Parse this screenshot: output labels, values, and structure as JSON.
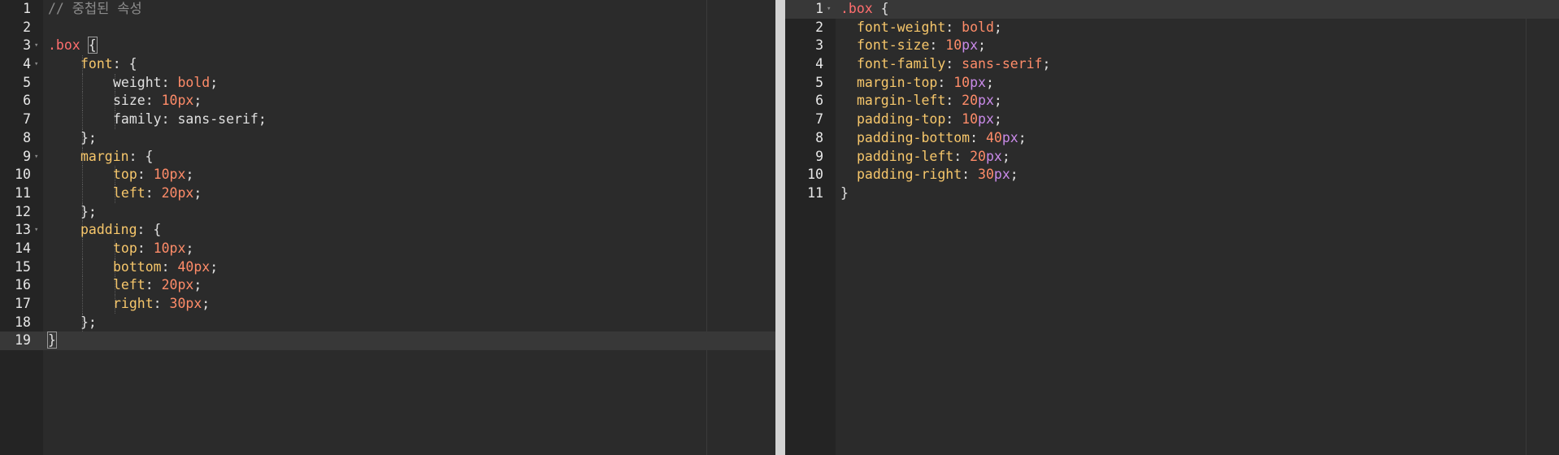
{
  "left_editor": {
    "lines": [
      {
        "n": "1",
        "fold": false,
        "indent": 0,
        "tokens": [
          {
            "t": "// 중첩된 속성",
            "c": "comment"
          }
        ]
      },
      {
        "n": "2",
        "fold": false,
        "indent": 0,
        "tokens": []
      },
      {
        "n": "3",
        "fold": true,
        "indent": 0,
        "tokens": [
          {
            "t": ".box",
            "c": "selector"
          },
          {
            "t": " ",
            "c": "plain"
          },
          {
            "t": "{",
            "c": "punct",
            "box": true
          }
        ]
      },
      {
        "n": "4",
        "fold": true,
        "indent": 1,
        "tokens": [
          {
            "t": "font",
            "c": "prop"
          },
          {
            "t": ": {",
            "c": "punct"
          }
        ]
      },
      {
        "n": "5",
        "fold": false,
        "indent": 2,
        "tokens": [
          {
            "t": "weight",
            "c": "plain"
          },
          {
            "t": ": ",
            "c": "punct"
          },
          {
            "t": "bold",
            "c": "value"
          },
          {
            "t": ";",
            "c": "punct"
          }
        ]
      },
      {
        "n": "6",
        "fold": false,
        "indent": 2,
        "tokens": [
          {
            "t": "size",
            "c": "plain"
          },
          {
            "t": ": ",
            "c": "punct"
          },
          {
            "t": "10px",
            "c": "num"
          },
          {
            "t": ";",
            "c": "punct"
          }
        ]
      },
      {
        "n": "7",
        "fold": false,
        "indent": 2,
        "tokens": [
          {
            "t": "family",
            "c": "plain"
          },
          {
            "t": ": ",
            "c": "punct"
          },
          {
            "t": "sans-serif",
            "c": "plain"
          },
          {
            "t": ";",
            "c": "punct"
          }
        ]
      },
      {
        "n": "8",
        "fold": false,
        "indent": 1,
        "tokens": [
          {
            "t": "};",
            "c": "punct"
          }
        ]
      },
      {
        "n": "9",
        "fold": true,
        "indent": 1,
        "tokens": [
          {
            "t": "margin",
            "c": "prop"
          },
          {
            "t": ": {",
            "c": "punct"
          }
        ]
      },
      {
        "n": "10",
        "fold": false,
        "indent": 2,
        "tokens": [
          {
            "t": "top",
            "c": "prop"
          },
          {
            "t": ": ",
            "c": "punct"
          },
          {
            "t": "10px",
            "c": "num"
          },
          {
            "t": ";",
            "c": "punct"
          }
        ]
      },
      {
        "n": "11",
        "fold": false,
        "indent": 2,
        "tokens": [
          {
            "t": "left",
            "c": "prop"
          },
          {
            "t": ": ",
            "c": "punct"
          },
          {
            "t": "20px",
            "c": "num"
          },
          {
            "t": ";",
            "c": "punct"
          }
        ]
      },
      {
        "n": "12",
        "fold": false,
        "indent": 1,
        "tokens": [
          {
            "t": "};",
            "c": "punct"
          }
        ]
      },
      {
        "n": "13",
        "fold": true,
        "indent": 1,
        "tokens": [
          {
            "t": "padding",
            "c": "prop"
          },
          {
            "t": ": {",
            "c": "punct"
          }
        ]
      },
      {
        "n": "14",
        "fold": false,
        "indent": 2,
        "tokens": [
          {
            "t": "top",
            "c": "prop"
          },
          {
            "t": ": ",
            "c": "punct"
          },
          {
            "t": "10px",
            "c": "num"
          },
          {
            "t": ";",
            "c": "punct"
          }
        ]
      },
      {
        "n": "15",
        "fold": false,
        "indent": 2,
        "tokens": [
          {
            "t": "bottom",
            "c": "prop"
          },
          {
            "t": ": ",
            "c": "punct"
          },
          {
            "t": "40px",
            "c": "num"
          },
          {
            "t": ";",
            "c": "punct"
          }
        ]
      },
      {
        "n": "16",
        "fold": false,
        "indent": 2,
        "tokens": [
          {
            "t": "left",
            "c": "prop"
          },
          {
            "t": ": ",
            "c": "punct"
          },
          {
            "t": "20px",
            "c": "num"
          },
          {
            "t": ";",
            "c": "punct"
          }
        ]
      },
      {
        "n": "17",
        "fold": false,
        "indent": 2,
        "tokens": [
          {
            "t": "right",
            "c": "prop"
          },
          {
            "t": ": ",
            "c": "punct"
          },
          {
            "t": "30px",
            "c": "num"
          },
          {
            "t": ";",
            "c": "punct"
          }
        ]
      },
      {
        "n": "18",
        "fold": false,
        "indent": 1,
        "tokens": [
          {
            "t": "};",
            "c": "punct"
          }
        ]
      },
      {
        "n": "19",
        "fold": false,
        "indent": 0,
        "active": true,
        "tokens": [
          {
            "t": "}",
            "c": "punct",
            "box": true
          }
        ]
      }
    ]
  },
  "right_editor": {
    "lines": [
      {
        "n": "1",
        "fold": true,
        "indent": 0,
        "active": true,
        "tokens": [
          {
            "t": ".box",
            "c": "selector"
          },
          {
            "t": " {",
            "c": "punct"
          }
        ]
      },
      {
        "n": "2",
        "fold": false,
        "indent": 1,
        "tokens": [
          {
            "t": "font-weight",
            "c": "prop"
          },
          {
            "t": ": ",
            "c": "punct"
          },
          {
            "t": "bold",
            "c": "value"
          },
          {
            "t": ";",
            "c": "punct"
          }
        ]
      },
      {
        "n": "3",
        "fold": false,
        "indent": 1,
        "tokens": [
          {
            "t": "font-size",
            "c": "prop"
          },
          {
            "t": ": ",
            "c": "punct"
          },
          {
            "t": "10",
            "c": "num"
          },
          {
            "t": "px",
            "c": "unit"
          },
          {
            "t": ";",
            "c": "punct"
          }
        ]
      },
      {
        "n": "4",
        "fold": false,
        "indent": 1,
        "tokens": [
          {
            "t": "font-family",
            "c": "prop"
          },
          {
            "t": ": ",
            "c": "punct"
          },
          {
            "t": "sans-serif",
            "c": "value"
          },
          {
            "t": ";",
            "c": "punct"
          }
        ]
      },
      {
        "n": "5",
        "fold": false,
        "indent": 1,
        "tokens": [
          {
            "t": "margin-top",
            "c": "prop"
          },
          {
            "t": ": ",
            "c": "punct"
          },
          {
            "t": "10",
            "c": "num"
          },
          {
            "t": "px",
            "c": "unit"
          },
          {
            "t": ";",
            "c": "punct"
          }
        ]
      },
      {
        "n": "6",
        "fold": false,
        "indent": 1,
        "tokens": [
          {
            "t": "margin-left",
            "c": "prop"
          },
          {
            "t": ": ",
            "c": "punct"
          },
          {
            "t": "20",
            "c": "num"
          },
          {
            "t": "px",
            "c": "unit"
          },
          {
            "t": ";",
            "c": "punct"
          }
        ]
      },
      {
        "n": "7",
        "fold": false,
        "indent": 1,
        "tokens": [
          {
            "t": "padding-top",
            "c": "prop"
          },
          {
            "t": ": ",
            "c": "punct"
          },
          {
            "t": "10",
            "c": "num"
          },
          {
            "t": "px",
            "c": "unit"
          },
          {
            "t": ";",
            "c": "punct"
          }
        ]
      },
      {
        "n": "8",
        "fold": false,
        "indent": 1,
        "tokens": [
          {
            "t": "padding-bottom",
            "c": "prop"
          },
          {
            "t": ": ",
            "c": "punct"
          },
          {
            "t": "40",
            "c": "num"
          },
          {
            "t": "px",
            "c": "unit"
          },
          {
            "t": ";",
            "c": "punct"
          }
        ]
      },
      {
        "n": "9",
        "fold": false,
        "indent": 1,
        "tokens": [
          {
            "t": "padding-left",
            "c": "prop"
          },
          {
            "t": ": ",
            "c": "punct"
          },
          {
            "t": "20",
            "c": "num"
          },
          {
            "t": "px",
            "c": "unit"
          },
          {
            "t": ";",
            "c": "punct"
          }
        ]
      },
      {
        "n": "10",
        "fold": false,
        "indent": 1,
        "tokens": [
          {
            "t": "padding-right",
            "c": "prop"
          },
          {
            "t": ": ",
            "c": "punct"
          },
          {
            "t": "30",
            "c": "num"
          },
          {
            "t": "px",
            "c": "unit"
          },
          {
            "t": ";",
            "c": "punct"
          }
        ]
      },
      {
        "n": "11",
        "fold": false,
        "indent": 0,
        "tokens": [
          {
            "t": "}",
            "c": "punct"
          }
        ]
      }
    ]
  },
  "fold_glyph": "▾"
}
